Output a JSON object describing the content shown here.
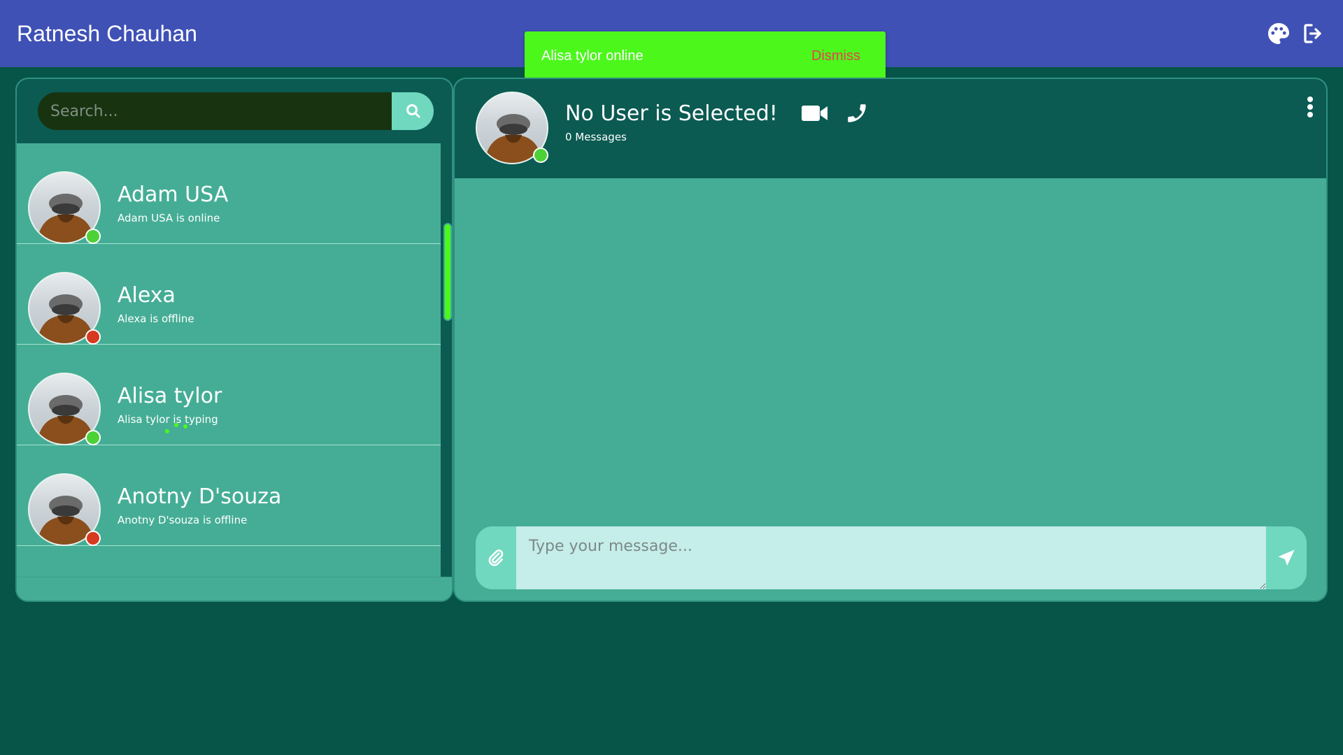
{
  "header": {
    "title": "Ratnesh Chauhan",
    "icons": [
      "palette-icon",
      "logout-icon"
    ]
  },
  "toast": {
    "message": "Alisa tylor online",
    "dismiss_label": "Dismiss"
  },
  "search": {
    "placeholder": "Search...",
    "button_icon": "search-icon"
  },
  "contacts": [
    {
      "name": "Adam USA",
      "status_text": "Adam USA is online",
      "presence": "online"
    },
    {
      "name": "Alexa",
      "status_text": "Alexa is offline",
      "presence": "offline"
    },
    {
      "name": "Alisa tylor",
      "status_text": "Alisa tylor is typing",
      "presence": "online"
    },
    {
      "name": "Anotny D'souza",
      "status_text": "Anotny D'souza is offline",
      "presence": "offline"
    }
  ],
  "chat": {
    "title": "No User is Selected!",
    "message_count": "0 Messages",
    "header_icons": [
      "video-camera-icon",
      "phone-icon",
      "more-vertical-icon"
    ]
  },
  "composer": {
    "placeholder": "Type your message...",
    "attach_icon": "paperclip-icon",
    "send_icon": "send-icon"
  },
  "colors": {
    "topbar": "#3f51b5",
    "background": "#075549",
    "panel": "#45ad96",
    "panel_header": "#0b5b52",
    "accent": "#6fd8bf",
    "toast": "#4cf71c",
    "dismiss": "#e8424a",
    "online": "#4cd137",
    "offline": "#d63a1f"
  }
}
